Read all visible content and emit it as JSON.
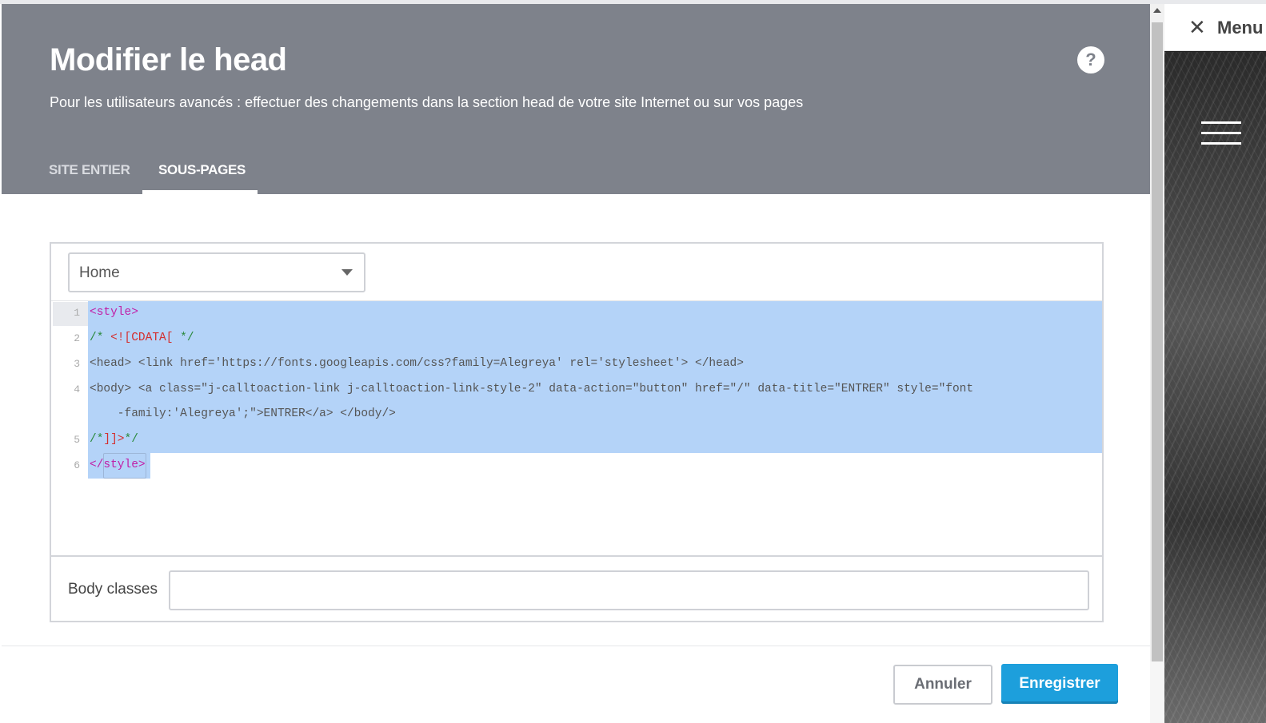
{
  "modal": {
    "title": "Modifier le head",
    "subtitle": "Pour les utilisateurs avancés : effectuer des changements dans la section head de votre site Internet ou sur vos pages",
    "help_label": "?",
    "tabs": [
      {
        "label": "SITE ENTIER",
        "active": false
      },
      {
        "label": "SOUS-PAGES",
        "active": true
      }
    ]
  },
  "page_select": {
    "value": "Home"
  },
  "editor": {
    "line_numbers": [
      "1",
      "2",
      "3",
      "4",
      "5",
      "6"
    ],
    "lines": {
      "l1": "<style>",
      "l2_comment_open": "/* ",
      "l2_cdata": "<![CDATA[",
      "l2_comment_close": " */",
      "l3": "<head> <link href='https://fonts.googleapis.com/css?family=Alegreya' rel='stylesheet'> </head>",
      "l4a": "<body> <a class=\"j-calltoaction-link j-calltoaction-link-style-2\" data-action=\"button\" href=\"/\" data-title=\"ENTRER\" style=\"font",
      "l4b": "    -family:'Alegreya';\">ENTRER</a> </body/>",
      "l5_comment_open": "/*",
      "l5_cdata": "]]>",
      "l5_comment_close": "*/",
      "l6": "</style>"
    }
  },
  "body_classes": {
    "label": "Body classes",
    "value": ""
  },
  "footer": {
    "cancel_label": "Annuler",
    "save_label": "Enregistrer"
  },
  "side": {
    "close_glyph": "✕",
    "menu_label": "Menu"
  }
}
